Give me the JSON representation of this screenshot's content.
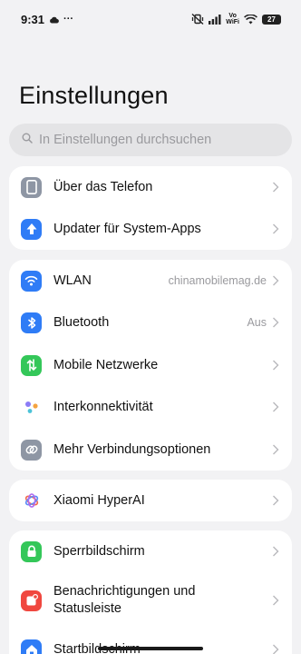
{
  "status_bar": {
    "time": "9:31",
    "notif_dots": "···",
    "volte_top": "Vo",
    "volte_bottom": "WiFi",
    "battery": "27"
  },
  "header": {
    "title": "Einstellungen"
  },
  "search": {
    "placeholder": "In Einstellungen durchsuchen"
  },
  "groups": {
    "device": {
      "about": {
        "label": "Über das Telefon"
      },
      "updater": {
        "label": "Updater für System-Apps"
      }
    },
    "connectivity": {
      "wlan": {
        "label": "WLAN",
        "value": "chinamobilemag.de"
      },
      "bluetooth": {
        "label": "Bluetooth",
        "value": "Aus"
      },
      "mobile": {
        "label": "Mobile Netzwerke"
      },
      "interconnect": {
        "label": "Interkonnektivität"
      },
      "more": {
        "label": "Mehr Verbindungsoptionen"
      }
    },
    "ai": {
      "hyperai": {
        "label": "Xiaomi HyperAI"
      }
    },
    "personalization": {
      "lockscreen": {
        "label": "Sperrbildschirm"
      },
      "notifications": {
        "label_line1": "Benachrichtigungen und",
        "label_line2": "Statusleiste"
      },
      "homescreen": {
        "label": "Startbildschirm"
      }
    }
  },
  "colors": {
    "background": "#f2f2f4",
    "card": "#ffffff",
    "about_icon": "#8e96a4",
    "updater_icon": "#2f7cf6",
    "wlan_icon": "#2f7cf6",
    "bluetooth_icon": "#2f7cf6",
    "mobile_icon": "#34c759",
    "more_icon": "#8e96a4",
    "lock_icon": "#34c759",
    "notif_icon": "#f0473f",
    "home_icon": "#2f7cf6"
  }
}
